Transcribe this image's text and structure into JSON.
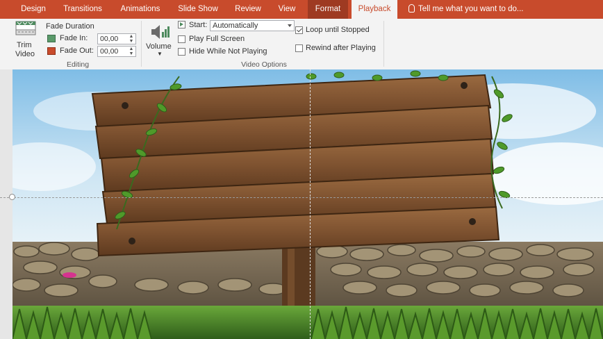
{
  "tabs": {
    "design": "Design",
    "transitions": "Transitions",
    "animations": "Animations",
    "slide_show": "Slide Show",
    "review": "Review",
    "view": "View",
    "format": "Format",
    "playback": "Playback"
  },
  "tell_me": "Tell me what you want to do...",
  "editing": {
    "trim_video_line1": "Trim",
    "trim_video_line2": "Video",
    "fade_duration": "Fade Duration",
    "fade_in_label": "Fade In:",
    "fade_in_value": "00,00",
    "fade_out_label": "Fade Out:",
    "fade_out_value": "00,00",
    "group_label": "Editing"
  },
  "video_options": {
    "volume_label": "Volume",
    "start_label": "Start:",
    "start_value": "Automatically",
    "play_full_screen": "Play Full Screen",
    "play_full_screen_checked": false,
    "hide_while_not_playing": "Hide While Not Playing",
    "hide_while_not_playing_checked": false,
    "loop_until_stopped": "Loop until Stopped",
    "loop_until_stopped_checked": true,
    "rewind_after_playing": "Rewind after Playing",
    "rewind_after_playing_checked": false,
    "group_label": "Video Options"
  },
  "colors": {
    "accent": "#c84b2c",
    "ribbon_bg": "#f3f3f3",
    "sky": "#b8dcf2",
    "wood": "#8a5a34",
    "stone": "#8c7c64",
    "grass": "#4f8a2a"
  }
}
